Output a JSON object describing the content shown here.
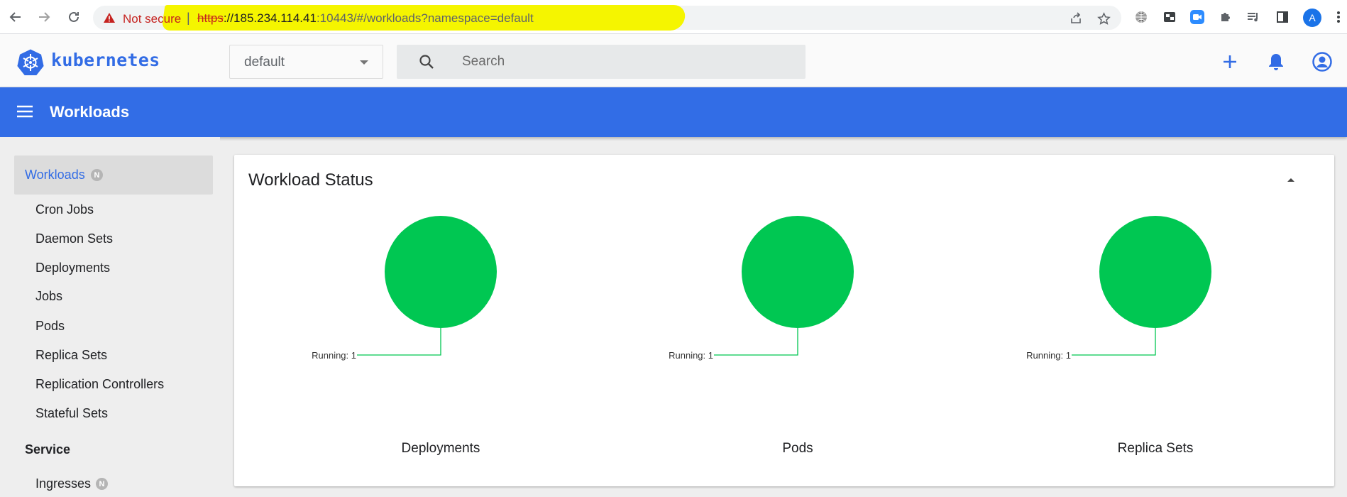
{
  "browser": {
    "security_label": "Not secure",
    "separator": "|",
    "url_proto": "https",
    "url_host": "://185.234.114.41",
    "url_path": ":10443/#/workloads?namespace=default",
    "profile_initial": "A",
    "icons": [
      "back-icon",
      "forward-icon",
      "reload-icon",
      "warning-icon",
      "share-icon",
      "star-icon",
      "globe-icon",
      "extension-icon",
      "zoom-icon",
      "puzzle-icon",
      "media-queue-icon",
      "side-panel-icon",
      "more-menu-icon"
    ]
  },
  "header": {
    "brand": "kubernetes",
    "namespace": "default",
    "search_placeholder": "Search",
    "icons": [
      "kubernetes-logo-icon",
      "add-icon",
      "notifications-icon",
      "account-icon"
    ],
    "accent_color": "#326ce5"
  },
  "toolbar": {
    "title": "Workloads",
    "color": "#326de6"
  },
  "sidebar": {
    "active": {
      "label": "Workloads",
      "badge": "N"
    },
    "items": [
      {
        "label": "Cron Jobs"
      },
      {
        "label": "Daemon Sets"
      },
      {
        "label": "Deployments"
      },
      {
        "label": "Jobs"
      },
      {
        "label": "Pods"
      },
      {
        "label": "Replica Sets"
      },
      {
        "label": "Replication Controllers"
      },
      {
        "label": "Stateful Sets"
      }
    ],
    "section": "Service",
    "service_items": [
      {
        "label": "Ingresses",
        "badge": "N"
      }
    ]
  },
  "card": {
    "title": "Workload Status"
  },
  "chart_data": [
    {
      "type": "pie",
      "title": "Deployments",
      "slices": [
        {
          "label": "Running",
          "value": 1,
          "color": "#00c752"
        }
      ]
    },
    {
      "type": "pie",
      "title": "Pods",
      "slices": [
        {
          "label": "Running",
          "value": 1,
          "color": "#00c752"
        }
      ]
    },
    {
      "type": "pie",
      "title": "Replica Sets",
      "slices": [
        {
          "label": "Running",
          "value": 1,
          "color": "#00c752"
        }
      ]
    }
  ]
}
